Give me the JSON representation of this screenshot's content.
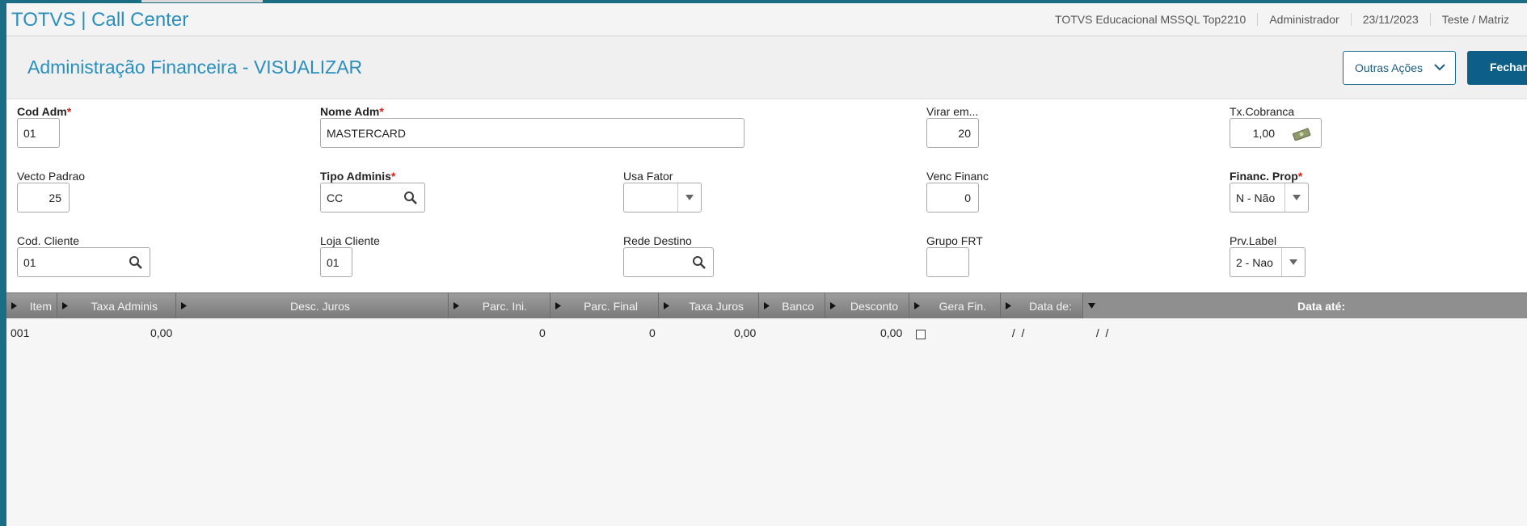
{
  "app": {
    "title": "TOTVS | Call Center",
    "environment": "TOTVS Educacional MSSQL Top2210",
    "user": "Administrador",
    "date": "23/11/2023",
    "branch": "Teste / Matriz"
  },
  "page": {
    "title": "Administração Financeira - VISUALIZAR",
    "actions_label": "Outras Ações",
    "close_label": "Fechar"
  },
  "form": {
    "cod_adm": {
      "label": "Cod Adm",
      "value": "01"
    },
    "nome_adm": {
      "label": "Nome Adm",
      "value": "MASTERCARD"
    },
    "virar_em": {
      "label": "Virar em...",
      "value": "20"
    },
    "tx_cobranca": {
      "label": "Tx.Cobranca",
      "value": "1,00"
    },
    "vecto_padrao": {
      "label": "Vecto Padrao",
      "value": "25"
    },
    "tipo_adminis": {
      "label": "Tipo Adminis",
      "value": "CC"
    },
    "usa_fator": {
      "label": "Usa Fator",
      "value": ""
    },
    "venc_financ": {
      "label": "Venc Financ",
      "value": "0"
    },
    "financ_prop": {
      "label": "Financ. Prop",
      "value": "N - Não"
    },
    "cod_cliente": {
      "label": "Cod. Cliente",
      "value": "01"
    },
    "loja_cliente": {
      "label": "Loja Cliente",
      "value": "01"
    },
    "rede_destino": {
      "label": "Rede Destino",
      "value": ""
    },
    "grupo_frt": {
      "label": "Grupo FRT",
      "value": ""
    },
    "prv_label": {
      "label": "Prv.Label",
      "value": "2 - Nao"
    },
    "required_mark": "*"
  },
  "grid": {
    "columns": [
      "Item",
      "Taxa Adminis",
      "Desc. Juros",
      "Parc. Ini.",
      "Parc. Final",
      "Taxa Juros",
      "Banco",
      "Desconto",
      "Gera Fin.",
      "Data de:",
      "Data até:"
    ],
    "rows": [
      {
        "item": "001",
        "taxa_adminis": "0,00",
        "desc_juros": "",
        "parc_ini": "0",
        "parc_final": "0",
        "taxa_juros": "0,00",
        "banco": "",
        "desconto": "0,00",
        "gera_fin": false,
        "data_de": " /  /",
        "data_ate": " /  /"
      }
    ]
  },
  "colors": {
    "accent": "#2a8fbd",
    "primary_button": "#0e5f88",
    "required": "#d91e18",
    "grid_header": "#8a8a8a"
  }
}
